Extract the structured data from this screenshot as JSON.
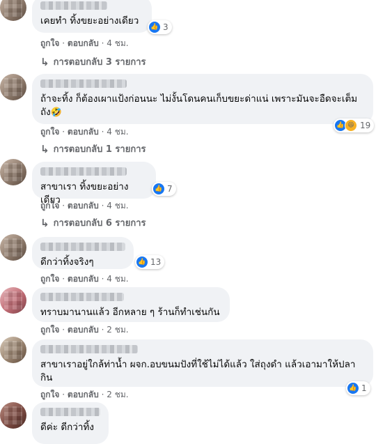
{
  "comments": [
    {
      "text": "เคยทำ ทิ้งขยะอย่างเดียว",
      "reaction_count": "3",
      "like": "ถูกใจ",
      "reply": "ตอบกลับ",
      "time": "4 ชม.",
      "replies": "การตอบกลับ 3 รายการ"
    },
    {
      "text": "ถ้าจะทิ้ง ก็ต้องเผาแป้งก่อนนะ ไม่งั้นโดนคนเก็บขยะด่าแน่ เพราะมันจะอืดจะเต็มถัง",
      "emoji": "🤣",
      "reaction_count": "19",
      "like": "ถูกใจ",
      "reply": "ตอบกลับ",
      "time": "4 ชม.",
      "replies": "การตอบกลับ 1 รายการ"
    },
    {
      "text": "สาขาเรา ทิ้งขยะอย่างเดียว",
      "reaction_count": "7",
      "like": "ถูกใจ",
      "reply": "ตอบกลับ",
      "time": "4 ชม.",
      "replies": "การตอบกลับ 6 รายการ"
    },
    {
      "text": "ดีกว่าทิ้งจริงๆ",
      "reaction_count": "13",
      "like": "ถูกใจ",
      "reply": "ตอบกลับ",
      "time": "4 ชม."
    },
    {
      "text": "ทราบมานานแล้ว อีกหลาย ๆ ร้านก็ทำเช่นกัน",
      "like": "ถูกใจ",
      "reply": "ตอบกลับ",
      "time": "2 ชม."
    },
    {
      "text": "สาขาเราอยู่ใกล้ท่าน้ำ ผจก.อบขนมปังที่ใช้ไม่ได้แล้ว ใส่ถุงดำ แล้วเอามาให้ปลากิน",
      "reaction_count": "1",
      "like": "ถูกใจ",
      "reply": "ตอบกลับ",
      "time": "2 ชม."
    },
    {
      "text": "ดีค่ะ ดีกว่าทิ้ง"
    }
  ],
  "separator": "·",
  "icons": {
    "like": "thumbs-up-icon",
    "haha": "haha-icon",
    "reply_arrow": "reply-arrow-icon"
  },
  "colors": {
    "like_blue": "#1877f2",
    "bubble": "#f0f2f5",
    "meta_gray": "#65676b"
  }
}
